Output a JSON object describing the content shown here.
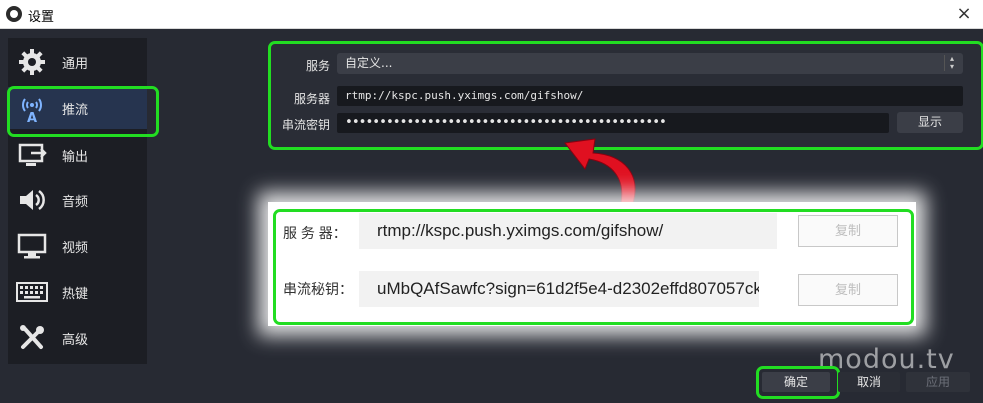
{
  "window": {
    "title": "设置",
    "close_symbol": "×"
  },
  "sidebar": {
    "items": [
      {
        "label": "通用",
        "icon": "gear-icon"
      },
      {
        "label": "推流",
        "icon": "broadcast-icon",
        "active": true
      },
      {
        "label": "输出",
        "icon": "output-icon"
      },
      {
        "label": "音频",
        "icon": "speaker-icon"
      },
      {
        "label": "视频",
        "icon": "monitor-icon"
      },
      {
        "label": "热键",
        "icon": "keyboard-icon"
      },
      {
        "label": "高级",
        "icon": "tools-icon"
      }
    ]
  },
  "stream": {
    "service_label": "服务",
    "service_value": "自定义...",
    "server_label": "服务器",
    "server_value": "rtmp://kspc.push.yximgs.com/gifshow/",
    "key_label": "串流密钥",
    "key_mask": "•••••••••••••••••••••••••••••••••••••••••••••••",
    "show_button": "显示"
  },
  "card": {
    "server_label": "服 务 器：",
    "server_value": "rtmp://kspc.push.yximgs.com/gifshow/",
    "key_label": "串流秘钥：",
    "key_value": "uMbQAfSawfc?sign=61d2f5e4-d2302effd807057ck",
    "copy_button": "复制"
  },
  "footer": {
    "ok": "确定",
    "cancel": "取消",
    "apply": "应用"
  },
  "watermark": "modou.tv",
  "colors": {
    "highlight": "#22dd22",
    "arrow": "#e01020",
    "background": "#272a33"
  }
}
